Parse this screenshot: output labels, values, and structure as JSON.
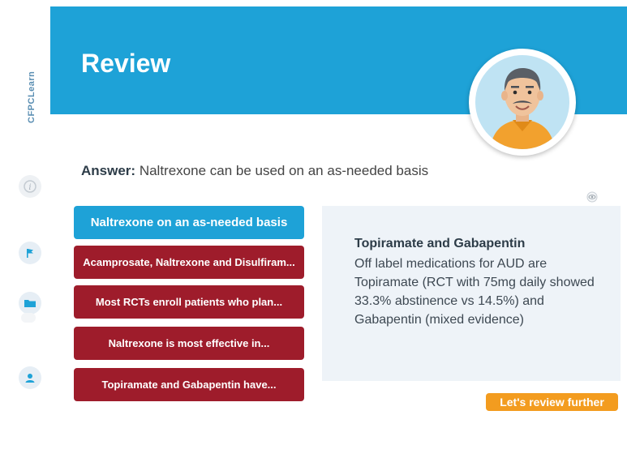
{
  "sidebar": {
    "logo_text": "CFPCLearn",
    "items": [
      {
        "name": "info",
        "icon": "info-icon"
      },
      {
        "name": "flag",
        "icon": "flag-icon"
      },
      {
        "name": "folder",
        "icon": "folder-icon"
      },
      {
        "name": "user",
        "icon": "user-icon"
      }
    ]
  },
  "header": {
    "title": "Review"
  },
  "answer": {
    "label": "Answer:",
    "text": "Naltrexone can be used on an as-needed basis"
  },
  "options": [
    "Naltrexone on an as-needed basis",
    "Acamprosate, Naltrexone and Disulfiram...",
    "Most RCTs enroll patients who plan...",
    "Naltrexone is most effective in...",
    "Topiramate and Gabapentin have..."
  ],
  "info": {
    "title": "Topiramate and Gabapentin",
    "body": "Off label medications for AUD are Topiramate (RCT with 75mg daily showed 33.3% abstinence vs 14.5%) and Gabapentin (mixed evidence)"
  },
  "review_button": "Let's review further",
  "colors": {
    "brand_blue": "#1ea2d7",
    "option_red": "#9e1c2b",
    "accent_orange": "#f39c1f",
    "panel_bg": "#eef3f8"
  }
}
